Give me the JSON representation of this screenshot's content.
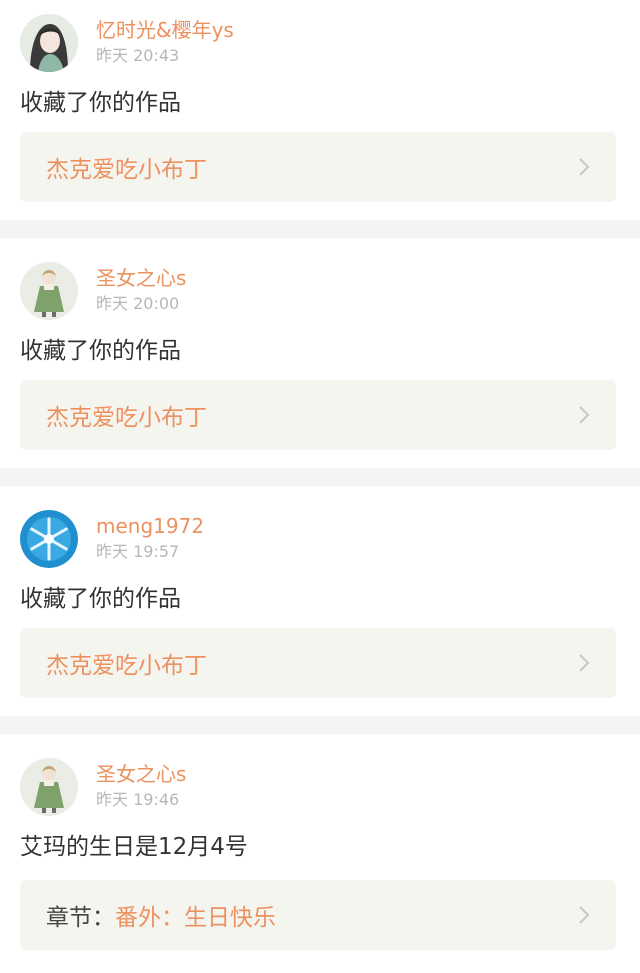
{
  "notifications": [
    {
      "username": "忆时光&樱年ys",
      "time": "昨天 20:43",
      "message": "收藏了你的作品",
      "link_prefix": "",
      "link": "杰克爱吃小布丁",
      "avatar": "avatar-girl-icon"
    },
    {
      "username": "圣女之心s",
      "time": "昨天 20:00",
      "message": "收藏了你的作品",
      "link_prefix": "",
      "link": "杰克爱吃小布丁",
      "avatar": "avatar-green-dress-icon"
    },
    {
      "username": "meng1972",
      "time": "昨天 19:57",
      "message": "收藏了你的作品",
      "link_prefix": "",
      "link": "杰克爱吃小布丁",
      "avatar": "avatar-snowflake-icon"
    },
    {
      "username": "圣女之心s",
      "time": "昨天 19:46",
      "message": "艾玛的生日是12月4号",
      "link_prefix": "章节：",
      "link": "番外：生日快乐",
      "avatar": "avatar-green-dress-icon"
    }
  ],
  "colors": {
    "accent": "#ec9160",
    "time": "#b7b7b7",
    "text": "#333333",
    "link_bg": "#f5f5ef",
    "separator": "#f4f4f2"
  }
}
